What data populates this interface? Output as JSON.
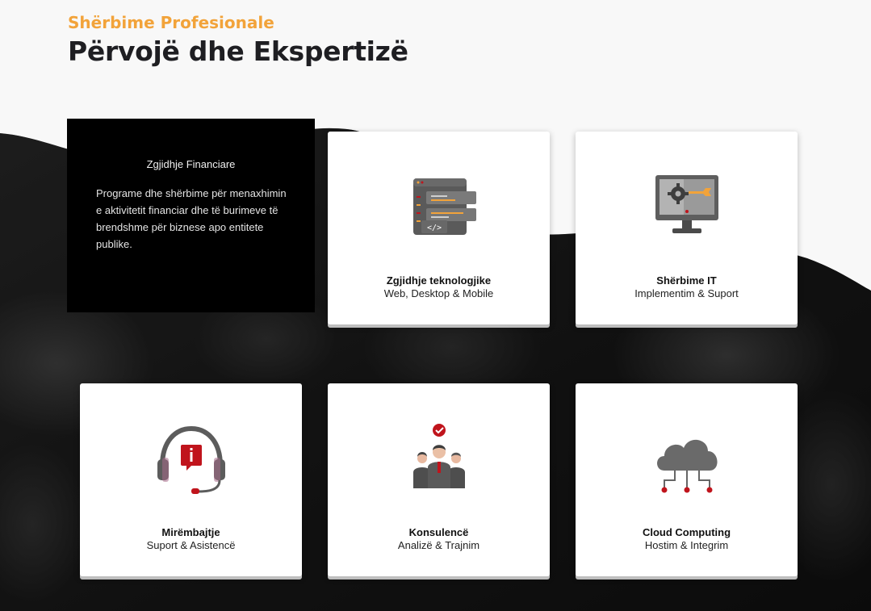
{
  "section": {
    "eyebrow": "Shërbime Profesionale",
    "title": "Përvojë dhe Ekspertizë"
  },
  "featured": {
    "title": "Zgjidhje Financiare",
    "description": "Programe dhe shërbime për menaxhimin e aktivitetit financiar dhe të burimeve të brendshme për biznese apo entitete publike."
  },
  "cards": [
    {
      "title": "Zgjidhje teknologjike",
      "subtitle": "Web, Desktop & Mobile",
      "icon": "server-code-icon"
    },
    {
      "title": "Shërbime IT",
      "subtitle": "Implementim & Suport",
      "icon": "monitor-gear-wrench-icon"
    },
    {
      "title": "Mirëmbajtje",
      "subtitle": "Suport & Asistencë",
      "icon": "headset-info-icon"
    },
    {
      "title": "Konsulencë",
      "subtitle": "Analizë & Trajnim",
      "icon": "team-check-icon"
    },
    {
      "title": "Cloud Computing",
      "subtitle": "Hostim & Integrim",
      "icon": "cloud-network-icon"
    }
  ],
  "colors": {
    "accent": "#f2a33a",
    "title": "#1e1e22",
    "icon_red": "#c0141c",
    "icon_gray": "#5c5c5c"
  }
}
